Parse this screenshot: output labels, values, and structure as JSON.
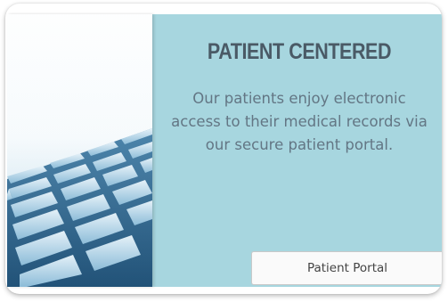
{
  "card": {
    "title": "PATIENT CENTERED",
    "description": "Our patients enjoy electronic access to their medical records via our secure patient portal.",
    "button_label": "Patient Portal",
    "image_icon": "keyboard-photo"
  },
  "colors": {
    "panel_background": "#a7d6df",
    "title": "#4a5a66",
    "body_text": "#637684",
    "button_background": "#fafafa"
  }
}
